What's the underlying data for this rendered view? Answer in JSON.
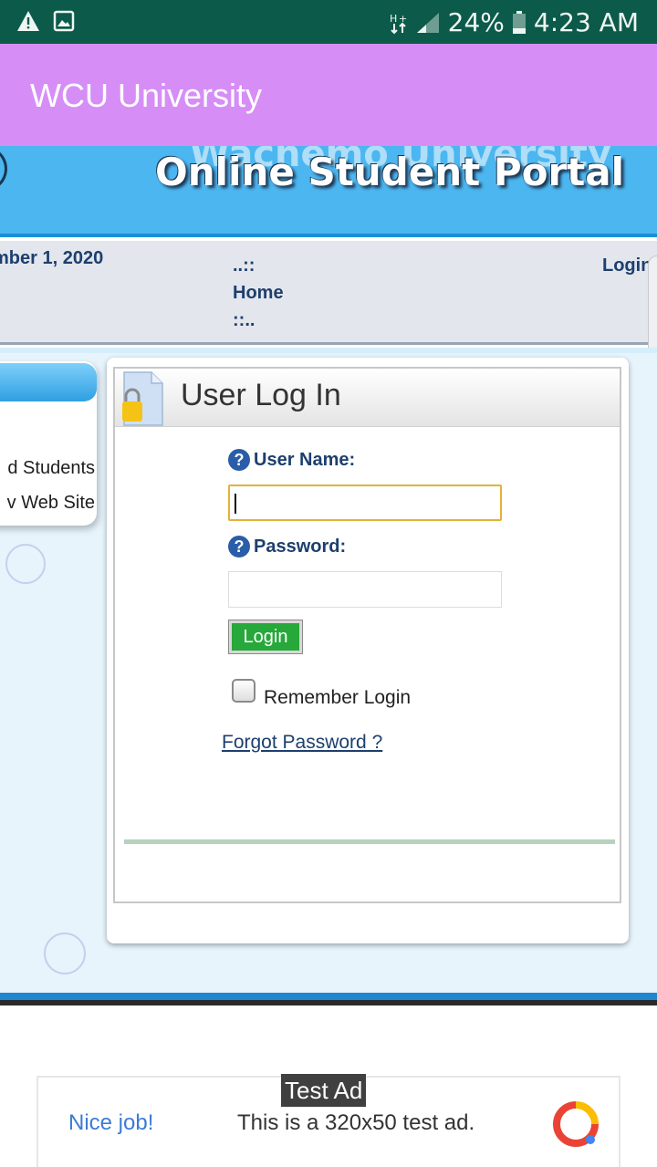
{
  "status_bar": {
    "battery": "24%",
    "time": "4:23 AM",
    "icons": [
      "warning-icon",
      "image-icon",
      "data-arrows-icon",
      "signal-icon",
      "battery-icon"
    ]
  },
  "app_bar": {
    "title": "WCU University"
  },
  "banner": {
    "ghost_text": "Wachemo University",
    "title": "Online Student Portal"
  },
  "nav": {
    "date": "mber 1, 2020",
    "home_top": "..::",
    "home_label": "Home",
    "home_bottom": "::..",
    "login": "Login"
  },
  "sidebar": {
    "items": [
      "d Students",
      "v Web Site"
    ]
  },
  "login_panel": {
    "title": "User Log In",
    "username_label": "User Name:",
    "username_value": "",
    "password_label": "Password:",
    "password_value": "",
    "login_button": "Login",
    "remember_label": "Remember Login",
    "remember_checked": false,
    "forgot_link": "Forgot Password ?"
  },
  "ad": {
    "label": "Test Ad",
    "nice": "Nice job!",
    "text": "This is a 320x50 test ad."
  },
  "colors": {
    "status_bar": "#0c5a4a",
    "app_bar": "#d68ef6",
    "banner": "#4cb6f0",
    "login_button": "#27a83a",
    "link": "#1d3f6e"
  }
}
